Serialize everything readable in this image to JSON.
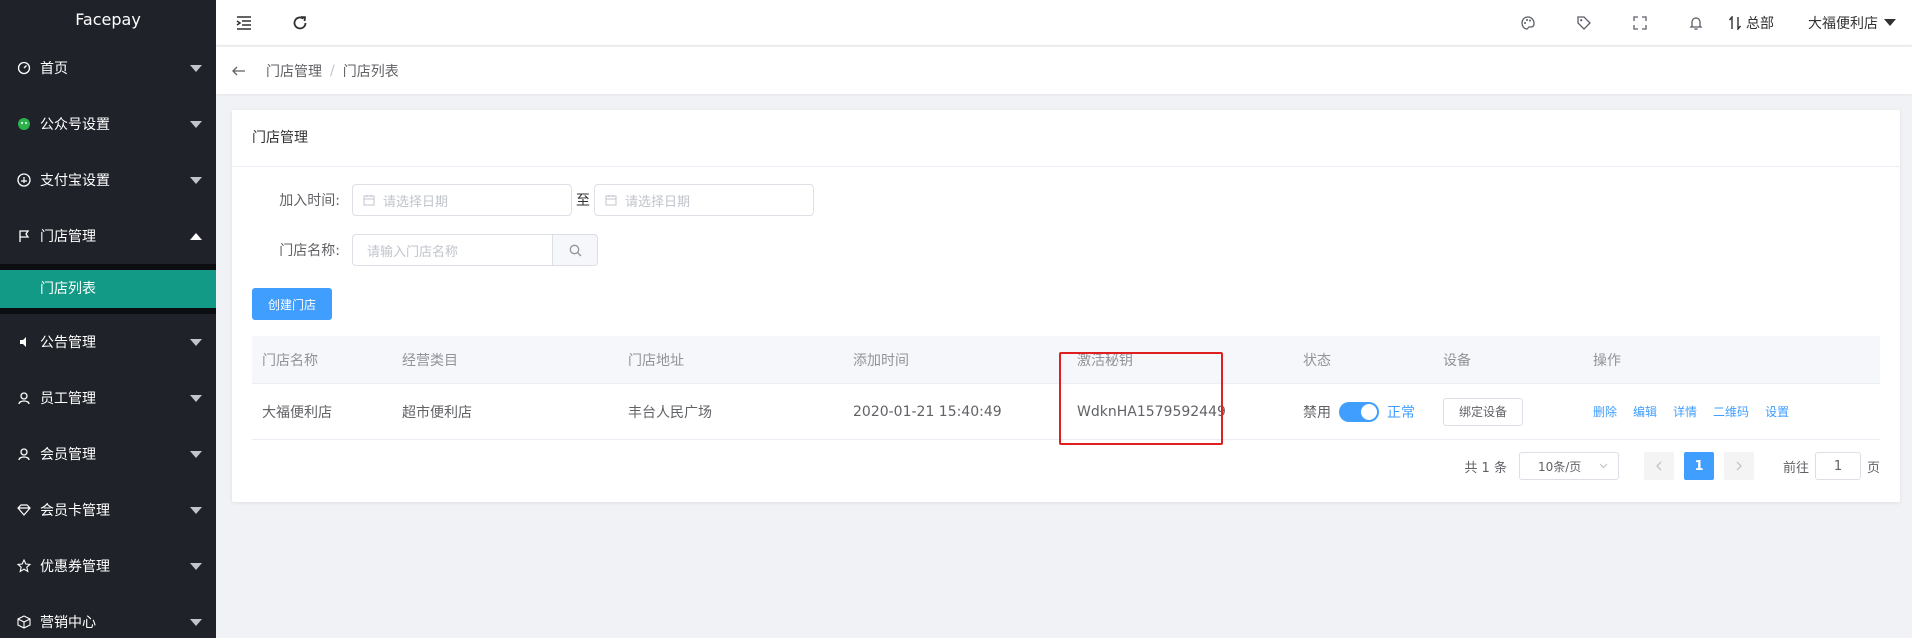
{
  "app": {
    "title": "Facepay"
  },
  "sidebar": {
    "items": [
      {
        "label": "首页",
        "icon": "dashboard-icon"
      },
      {
        "label": "公众号设置",
        "icon": "wechat-icon"
      },
      {
        "label": "支付宝设置",
        "icon": "alipay-icon"
      },
      {
        "label": "门店管理",
        "icon": "flag-icon",
        "expanded": true
      },
      {
        "label": "公告管理",
        "icon": "speaker-icon"
      },
      {
        "label": "员工管理",
        "icon": "user-icon"
      },
      {
        "label": "会员管理",
        "icon": "member-icon"
      },
      {
        "label": "会员卡管理",
        "icon": "diamond-icon"
      },
      {
        "label": "优惠券管理",
        "icon": "star-icon"
      },
      {
        "label": "营销中心",
        "icon": "box-icon"
      }
    ],
    "sub_items": [
      {
        "label": "门店列表",
        "active": true
      }
    ]
  },
  "header": {
    "hq_label": "总部",
    "store_label": "大福便利店",
    "icons": [
      "menu-fold-icon",
      "refresh-icon",
      "palette-icon",
      "tag-icon",
      "fullscreen-icon",
      "bell-icon",
      "switch-icon"
    ]
  },
  "breadcrumb": {
    "items": [
      "门店管理",
      "门店列表"
    ],
    "separator": "/"
  },
  "card": {
    "title": "门店管理"
  },
  "form": {
    "join_time_label": "加入时间:",
    "date_placeholder_start": "请选择日期",
    "to_label": "至",
    "date_placeholder_end": "请选择日期",
    "store_name_label": "门店名称:",
    "store_name_placeholder": "请输入门店名称",
    "create_button": "创建门店"
  },
  "table": {
    "headers": [
      "门店名称",
      "经营类目",
      "门店地址",
      "添加时间",
      "激活秘钥",
      "状态",
      "设备",
      "操作"
    ],
    "rows": [
      {
        "name": "大福便利店",
        "category": "超市便利店",
        "address": "丰台人民广场",
        "added": "2020-01-21 15:40:49",
        "key": "WdknHA1579592449",
        "status_off": "禁用",
        "status_on": "正常",
        "status_enabled": true,
        "device_button": "绑定设备",
        "ops": [
          "删除",
          "编辑",
          "详情",
          "二维码",
          "设置"
        ]
      }
    ]
  },
  "pagination": {
    "total_text": "共 1 条",
    "page_size": "10条/页",
    "current_page": "1",
    "goto_label": "前往",
    "goto_value": "1",
    "page_unit": "页"
  },
  "colors": {
    "primary": "#409eff",
    "sidebar_bg": "#1f2329",
    "active_submenu": "#139a86",
    "highlight_box": "#e02020"
  }
}
